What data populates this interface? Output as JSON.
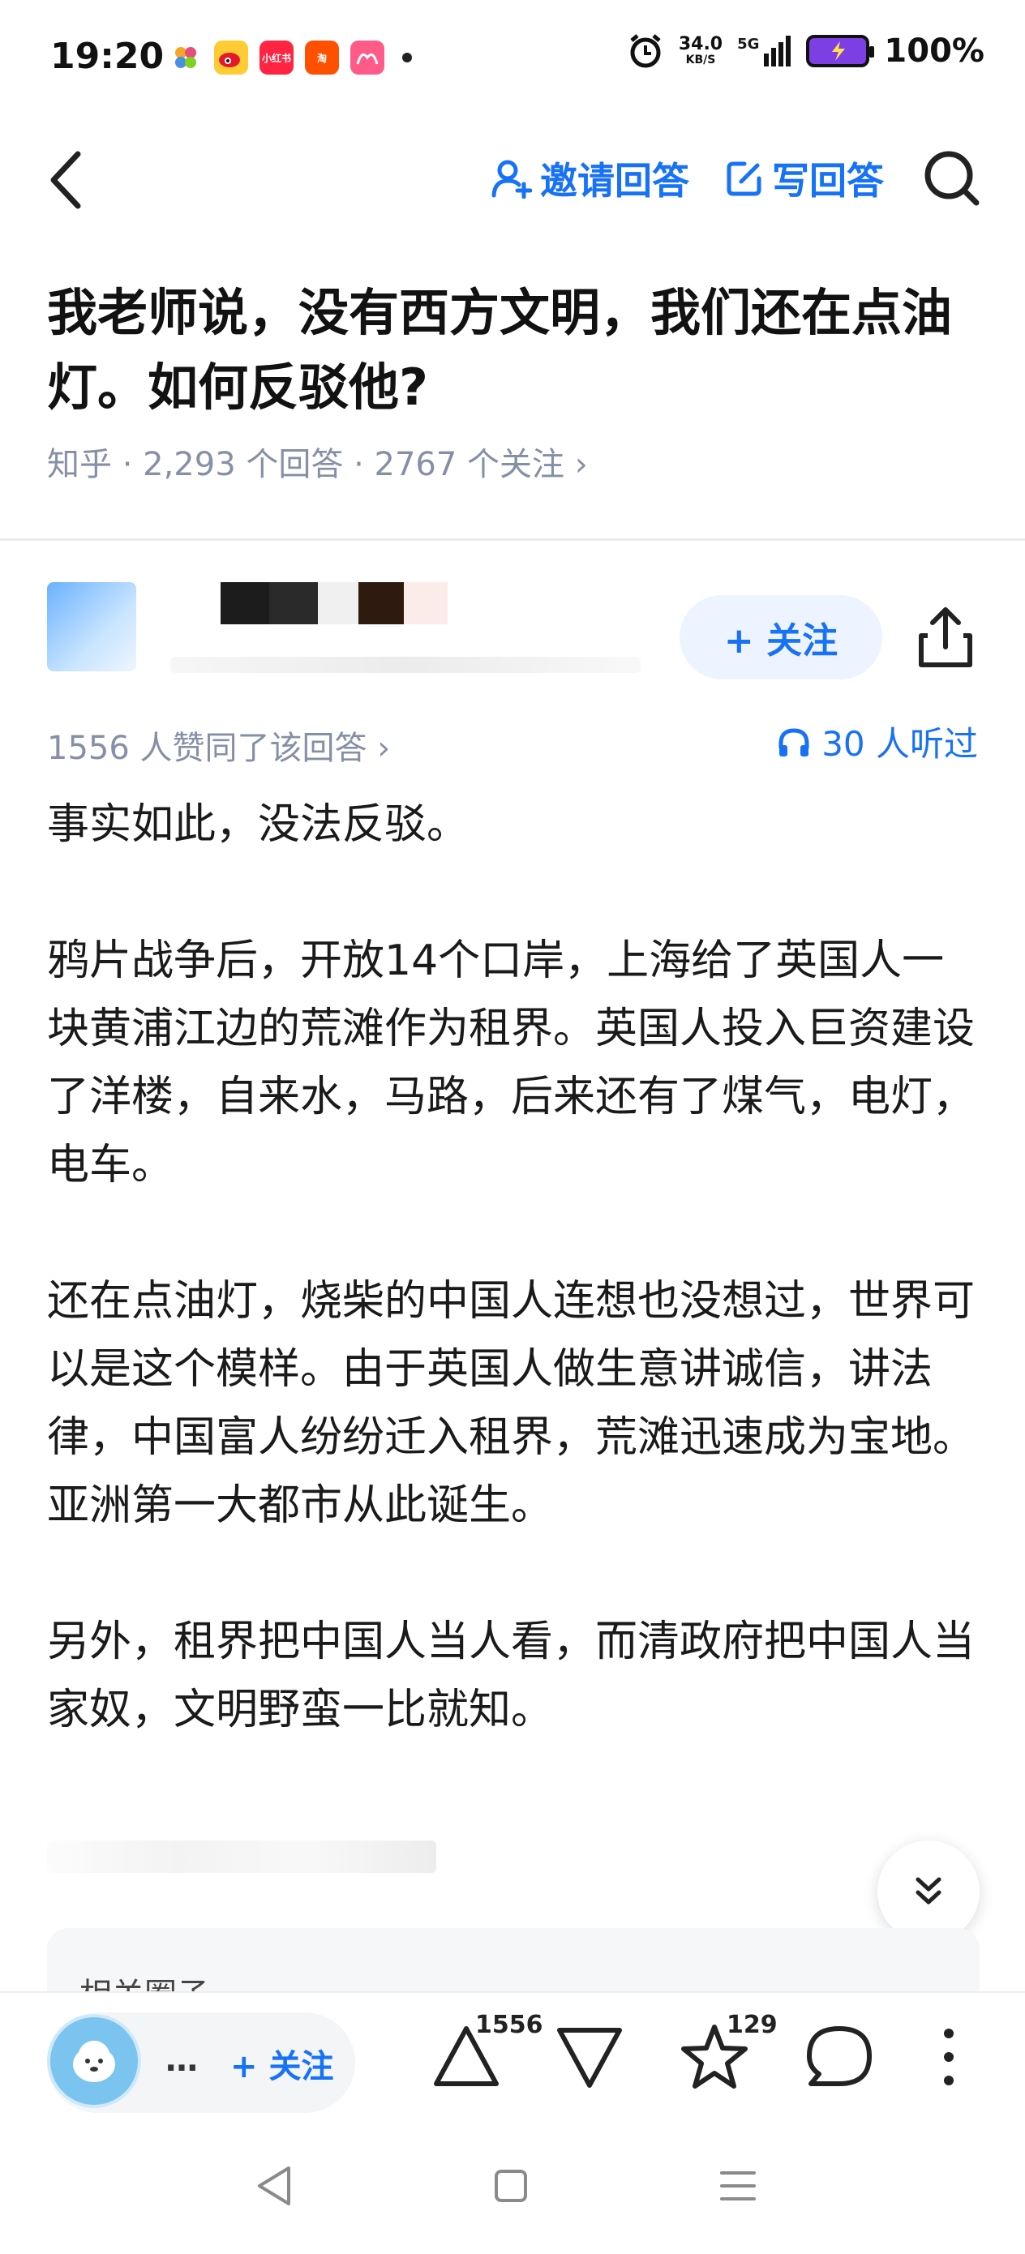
{
  "status_bar": {
    "time": "19:20",
    "net_speed": "34.0",
    "net_unit": "KB/S",
    "signal": "5G",
    "battery": "100%",
    "app_icons": [
      "app-icon-1",
      "weibo-icon",
      "xiaohongshu-icon",
      "taobao-icon",
      "app-icon-5"
    ]
  },
  "nav": {
    "invite_label": "邀请回答",
    "write_label": "写回答"
  },
  "question": {
    "title": "我老师说，没有西方文明，我们还在点油灯。如何反驳他?",
    "meta": "知乎 · 2,293 个回答 · 2767 个关注 ›"
  },
  "author": {
    "follow_label": "+ 关注"
  },
  "answer": {
    "votes_text": "1556 人赞同了该回答 ›",
    "listened_text": "30 人听过",
    "paragraphs": [
      "事实如此，没法反驳。",
      "鸦片战争后，开放14个口岸，上海给了英国人一块黄浦江边的荒滩作为租界。英国人投入巨资建设了洋楼，自来水，马路，后来还有了煤气，电灯，电车。",
      "还在点油灯，烧柴的中国人连想也没想过，世界可以是这个模样。由于英国人做生意讲诚信，讲法律，中国富人纷纷迁入租界，荒滩迅速成为宝地。亚洲第一大都市从此诞生。",
      "另外，租界把中国人当人看，而清政府把中国人当家奴，文明野蛮一比就知。"
    ]
  },
  "related": {
    "title": "相关圈子"
  },
  "bottom_bar": {
    "author_dots": "…",
    "follow_label": "+ 关注",
    "upvote_count": "1556",
    "favorite_count": "129"
  },
  "colors": {
    "accent": "#1772f6",
    "meta": "#8590a6"
  }
}
